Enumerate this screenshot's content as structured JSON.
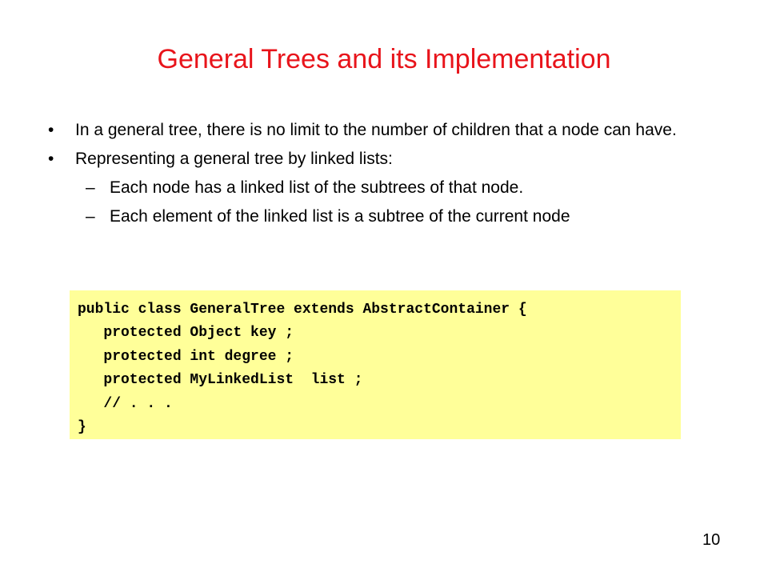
{
  "slide": {
    "title": "General Trees and its Implementation",
    "bullet_marker": "•",
    "sub_marker": "–",
    "bullets": [
      {
        "text": "In a general tree, there is no limit to the number of children that a node can have."
      },
      {
        "text": "Representing a general tree by linked lists:",
        "subs": [
          "Each node has a linked list of the subtrees of that node.",
          "Each element of the linked list is a subtree of the current node"
        ]
      }
    ],
    "code_lines": [
      "public class GeneralTree extends AbstractContainer {",
      "   protected Object key ;",
      "   protected int degree ;",
      "   protected MyLinkedList  list ;",
      "   // . . .",
      "}"
    ],
    "page_number": "10",
    "colors": {
      "title": "#e8141b",
      "code_background": "#ffff99"
    }
  }
}
